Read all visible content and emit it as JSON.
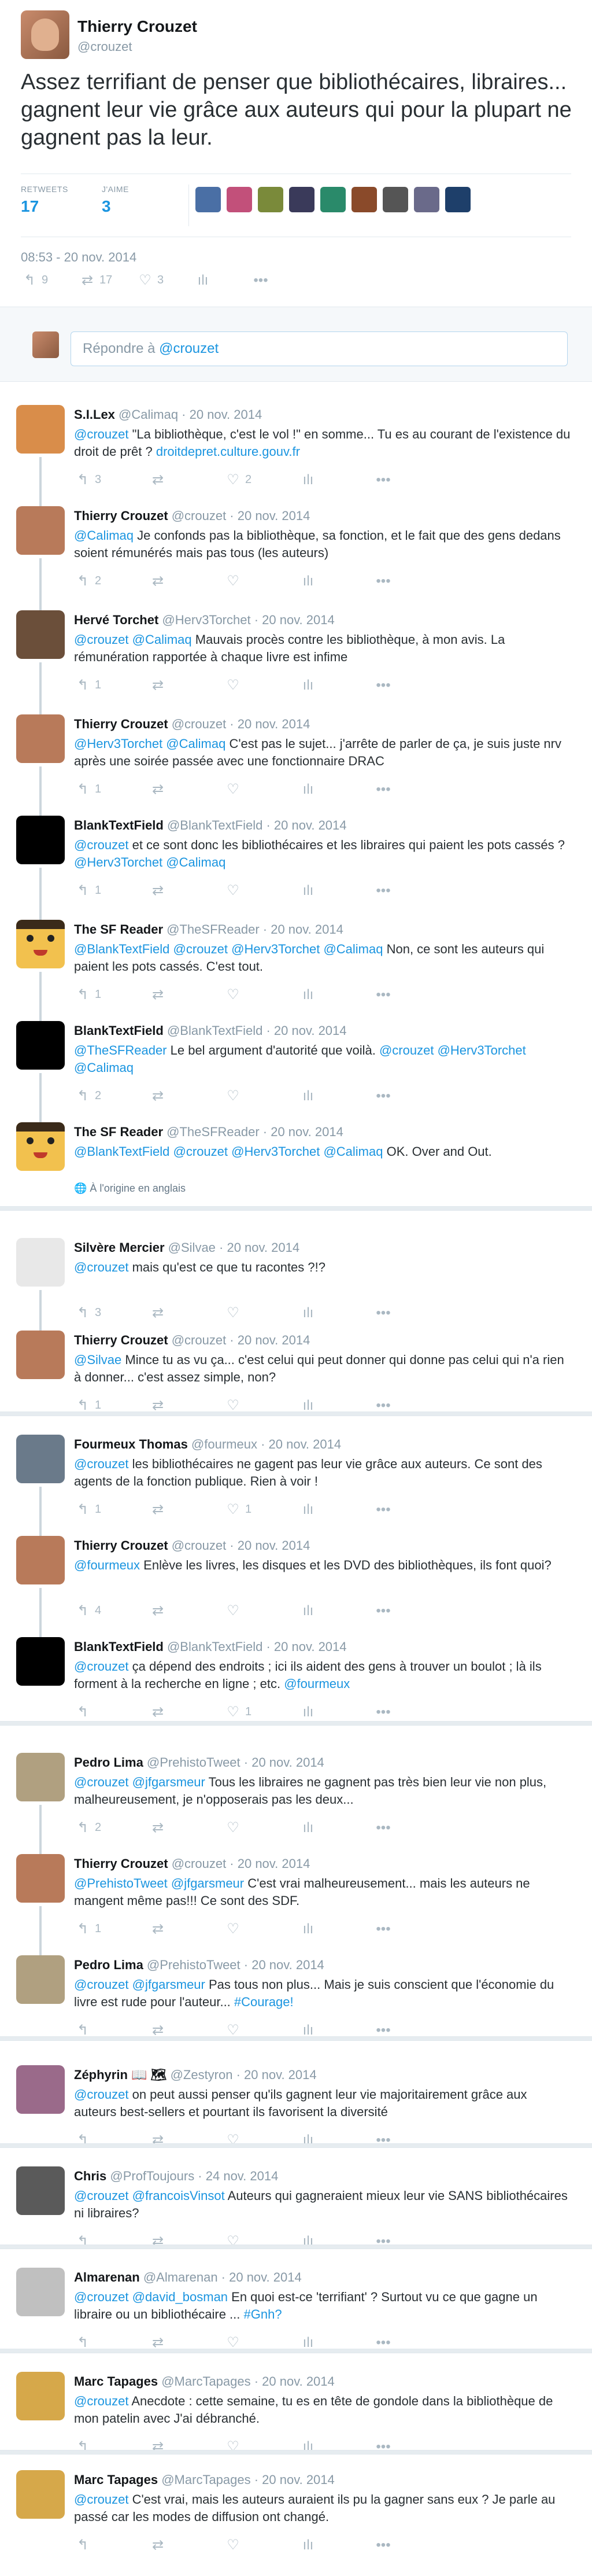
{
  "author": {
    "name": "Thierry Crouzet",
    "handle": "@crouzet"
  },
  "tweet": {
    "text": "Assez terrifiant de penser que bibliothécaires, libraires... gagnent leur vie grâce aux auteurs qui pour la plupart ne gagnent pas la leur.",
    "retweets_label": "RETWEETS",
    "retweets": "17",
    "likes_label": "J'AIME",
    "likes": "3",
    "timestamp": "08:53 - 20 nov. 2014",
    "actions": {
      "replies": "9",
      "retweets": "17",
      "likes": "3"
    }
  },
  "reply_box": {
    "prefix": "Répondre à ",
    "handle": "@crouzet"
  },
  "icons": {
    "reply": "↰",
    "retweet": "⇄",
    "like": "♡",
    "analytics": "ılı",
    "more": "•••",
    "dm": "✉",
    "globe": "🌐"
  },
  "replies": [
    {
      "name": "S.I.Lex",
      "handle": "@Calimaq",
      "date": "20 nov. 2014",
      "text": "<u>@crouzet</u> \"La bibliothèque, c'est le vol !\" en somme... Tu es au courant de l'existence du droit de prêt ? <u>droitdepret.culture.gouv.fr</u>",
      "reply": "3",
      "rt": "",
      "like": "2"
    },
    {
      "name": "Thierry Crouzet",
      "handle": "@crouzet",
      "date": "20 nov. 2014",
      "text": "<u>@Calimaq</u> Je confonds pas la bibliothèque, sa fonction, et le fait que des gens dedans soient rémunérés mais pas tous (les auteurs)",
      "reply": "2",
      "rt": "",
      "like": ""
    },
    {
      "name": "Hervé Torchet",
      "handle": "@Herv3Torchet",
      "date": "20 nov. 2014",
      "text": "<u>@crouzet</u> <u>@Calimaq</u> Mauvais procès contre les bibliothèque, à mon avis. La rémunération rapportée à chaque livre est infime",
      "reply": "1",
      "rt": "",
      "like": ""
    },
    {
      "name": "Thierry Crouzet",
      "handle": "@crouzet",
      "date": "20 nov. 2014",
      "text": "<u>@Herv3Torchet</u> <u>@Calimaq</u> C'est pas le sujet... j'arrête de parler de ça, je suis juste nrv après une soirée passée avec une fonctionnaire DRAC",
      "reply": "1",
      "rt": "",
      "like": ""
    },
    {
      "name": "BlankTextField",
      "handle": "@BlankTextField",
      "date": "20 nov. 2014",
      "text": "<u>@crouzet</u> et ce sont donc les bibliothécaires et les libraires qui paient les pots cassés ? <u>@Herv3Torchet</u> <u>@Calimaq</u>",
      "reply": "1",
      "rt": "",
      "like": ""
    },
    {
      "name": "The SF Reader",
      "handle": "@TheSFReader",
      "date": "20 nov. 2014",
      "text": "<u>@BlankTextField</u> <u>@crouzet</u> <u>@Herv3Torchet</u> <u>@Calimaq</u> Non, ce sont les auteurs qui paient les pots cassés. C'est tout.",
      "reply": "1",
      "rt": "",
      "like": ""
    },
    {
      "name": "BlankTextField",
      "handle": "@BlankTextField",
      "date": "20 nov. 2014",
      "text": "<u>@TheSFReader</u> Le bel argument d'autorité que voilà. <u>@crouzet</u> <u>@Herv3Torchet</u> <u>@Calimaq</u>",
      "reply": "2",
      "rt": "",
      "like": ""
    },
    {
      "name": "The SF Reader",
      "handle": "@TheSFReader",
      "date": "20 nov. 2014",
      "text": "<u>@BlankTextField</u> <u>@crouzet</u> <u>@Herv3Torchet</u> <u>@Calimaq</u> OK. Over and Out.",
      "note": "À l'origine en anglais",
      "reply": "",
      "rt": "",
      "like": ""
    },
    {
      "name": "Silvère Mercier",
      "handle": "@Silvae",
      "date": "20 nov. 2014",
      "text": "<u>@crouzet</u> mais qu'est ce que tu racontes ?!?",
      "reply": "3",
      "rt": "",
      "like": ""
    },
    {
      "name": "Thierry Crouzet",
      "handle": "@crouzet",
      "date": "20 nov. 2014",
      "text": "<u>@Silvae</u> Mince tu as vu ça... c'est celui qui peut donner qui donne pas celui qui n'a rien à donner... c'est assez simple, non?",
      "reply": "1",
      "rt": "",
      "like": ""
    },
    {
      "name": "Fourmeux Thomas",
      "handle": "@fourmeux",
      "date": "20 nov. 2014",
      "text": "<u>@crouzet</u> les bibliothécaires ne gagent pas leur vie grâce aux auteurs. Ce sont des agents de la fonction publique. Rien à voir !",
      "reply": "1",
      "rt": "",
      "like": "1"
    },
    {
      "name": "Thierry Crouzet",
      "handle": "@crouzet",
      "date": "20 nov. 2014",
      "text": "<u>@fourmeux</u> Enlève les livres, les disques et les DVD des bibliothèques, ils font quoi?",
      "reply": "4",
      "rt": "",
      "like": ""
    },
    {
      "name": "BlankTextField",
      "handle": "@BlankTextField",
      "date": "20 nov. 2014",
      "text": "<u>@crouzet</u> ça dépend des endroits ; ici ils aident des gens à trouver un boulot ; là ils forment à la recherche en ligne ; etc. <u>@fourmeux</u>",
      "reply": "",
      "rt": "",
      "like": "1"
    },
    {
      "name": "Pedro Lima",
      "handle": "@PrehistoTweet",
      "date": "20 nov. 2014",
      "text": "<u>@crouzet</u> <u>@jfgarsmeur</u> Tous les libraires ne gagnent pas très bien leur vie non plus, malheureusement, je n'opposerais pas les deux...",
      "reply": "2",
      "rt": "",
      "like": ""
    },
    {
      "name": "Thierry Crouzet",
      "handle": "@crouzet",
      "date": "20 nov. 2014",
      "text": "<u>@PrehistoTweet</u> <u>@jfgarsmeur</u> C'est vrai malheureusement... mais les auteurs ne mangent même pas!!! Ce sont des SDF.",
      "reply": "1",
      "rt": "",
      "like": ""
    },
    {
      "name": "Pedro Lima",
      "handle": "@PrehistoTweet",
      "date": "20 nov. 2014",
      "text": "<u>@crouzet</u> <u>@jfgarsmeur</u> Pas tous non plus... Mais je suis conscient que l'économie du livre est rude pour l'auteur... <u>#Courage!</u>",
      "reply": "",
      "rt": "",
      "like": ""
    },
    {
      "name": "Zéphyrin 📖 🗺",
      "handle": "@Zestyron",
      "date": "20 nov. 2014",
      "text": "<u>@crouzet</u> on peut aussi penser qu'ils gagnent leur vie majoritairement grâce aux auteurs best-sellers et pourtant ils favorisent la diversité",
      "reply": "",
      "rt": "",
      "like": ""
    },
    {
      "name": "Chris",
      "handle": "@ProfToujours",
      "date": "24 nov. 2014",
      "text": "<u>@crouzet</u> <u>@francoisVinsot</u> Auteurs qui gagneraient mieux leur vie SANS bibliothécaires ni libraires?",
      "reply": "",
      "rt": "",
      "like": ""
    },
    {
      "name": "Almarenan",
      "handle": "@Almarenan",
      "date": "20 nov. 2014",
      "text": "<u>@crouzet</u> <u>@david_bosman</u> En quoi est-ce 'terrifiant' ? Surtout vu ce que gagne un libraire ou un bibliothécaire ... <u>#Gnh?</u>",
      "reply": "",
      "rt": "",
      "like": ""
    },
    {
      "name": "Marc Tapages",
      "handle": "@MarcTapages",
      "date": "20 nov. 2014",
      "text": "<u>@crouzet</u> Anecdote : cette semaine, tu es en tête de gondole dans la bibliothèque de mon patelin avec J'ai débranché.",
      "reply": "",
      "rt": "",
      "like": ""
    },
    {
      "name": "Marc Tapages",
      "handle": "@MarcTapages",
      "date": "20 nov. 2014",
      "text": "<u>@crouzet</u> C'est vrai, mais les auteurs auraient ils pu la gagner sans eux ? Je parle au passé car les modes de diffusion ont changé.",
      "reply": "",
      "rt": "",
      "like": ""
    }
  ]
}
